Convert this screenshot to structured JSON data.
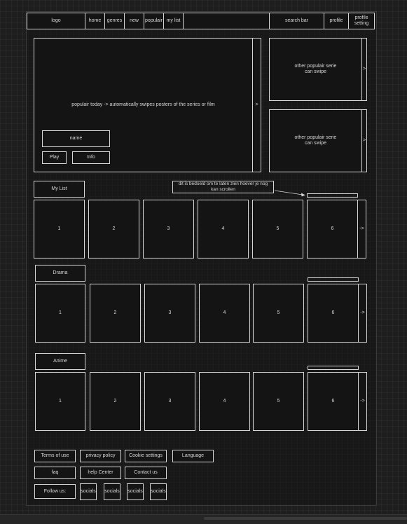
{
  "header": {
    "logo": "logo",
    "nav": [
      "home",
      "genres",
      "new",
      "populair",
      "my list"
    ],
    "search": "search bar",
    "profile": "profile",
    "profile_setting": "profile\nsetting"
  },
  "hero": {
    "text": "populair today -> automatically swipes posters of the series or film",
    "arrow": ">",
    "name_label": "name",
    "play_label": "Play",
    "info_label": "Info"
  },
  "side_popular": [
    {
      "text": "other populair serie\ncan swipe",
      "arrow": ">"
    },
    {
      "text": "other populair serie\ncan swipe",
      "arrow": ">"
    }
  ],
  "annotation": "dit is bedoeld om te laten zien hoever je nog\nkan scrollen",
  "rows": [
    {
      "title": "My List",
      "items": [
        "1",
        "2",
        "3",
        "4",
        "5",
        "6"
      ],
      "arrow": "->"
    },
    {
      "title": "Drama",
      "items": [
        "1",
        "2",
        "3",
        "4",
        "5",
        "6"
      ],
      "arrow": "->"
    },
    {
      "title": "Anime",
      "items": [
        "1",
        "2",
        "3",
        "4",
        "5",
        "6"
      ],
      "arrow": "->"
    }
  ],
  "footer": {
    "links_row1": [
      "Terms of use",
      "privacy policy",
      "Cookie settings",
      "Language"
    ],
    "links_row2": [
      "faq",
      "help Center",
      "Contact us"
    ],
    "follow_label": "Follow us:",
    "socials": [
      "socials",
      "socials",
      "socials",
      "socials"
    ]
  }
}
